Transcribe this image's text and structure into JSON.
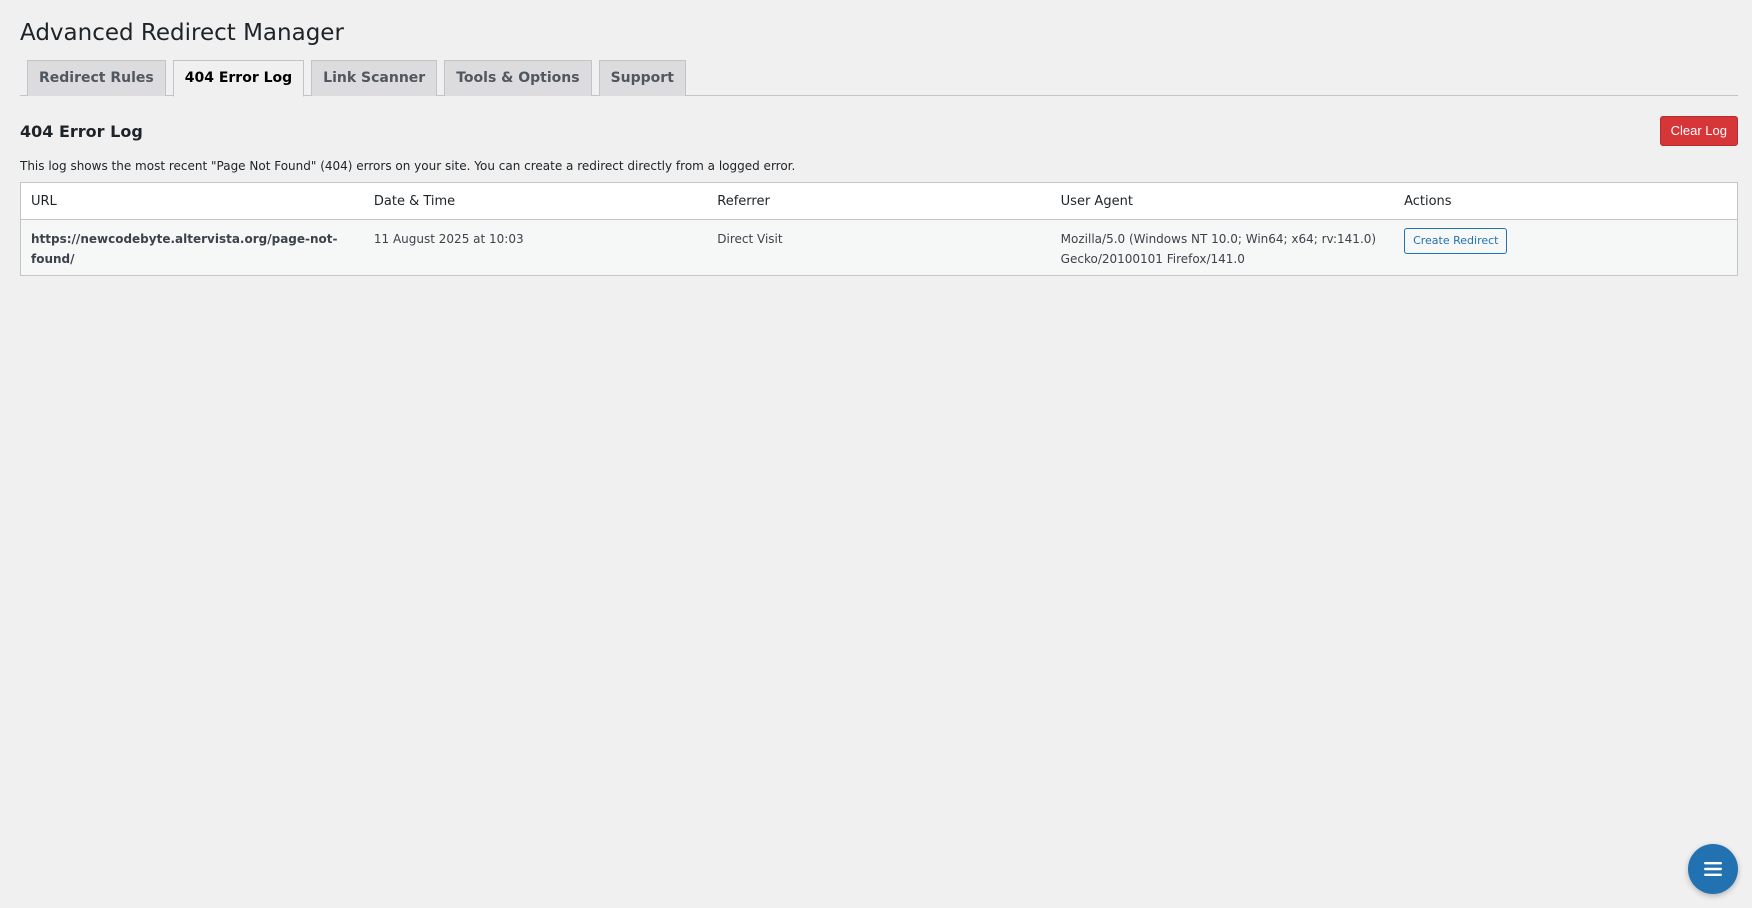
{
  "page": {
    "title": "Advanced Redirect Manager"
  },
  "tabs": [
    {
      "label": "Redirect Rules",
      "active": false
    },
    {
      "label": "404 Error Log",
      "active": true
    },
    {
      "label": "Link Scanner",
      "active": false
    },
    {
      "label": "Tools & Options",
      "active": false
    },
    {
      "label": "Support",
      "active": false
    }
  ],
  "section": {
    "title": "404 Error Log",
    "clear_button": "Clear Log",
    "description": "This log shows the most recent \"Page Not Found\" (404) errors on your site. You can create a redirect directly from a logged error."
  },
  "table": {
    "headers": {
      "url": "URL",
      "date": "Date & Time",
      "referrer": "Referrer",
      "user_agent": "User Agent",
      "actions": "Actions"
    },
    "rows": [
      {
        "url": "https://newcodebyte.altervista.org/page-not-found/",
        "date": "11 August 2025 at 10:03",
        "referrer": "Direct Visit",
        "user_agent": "Mozilla/5.0 (Windows NT 10.0; Win64; x64; rv:141.0) Gecko/20100101 Firefox/141.0",
        "action": "Create Redirect"
      }
    ]
  },
  "colors": {
    "danger": "#d63638",
    "primary": "#2271b1",
    "background": "#f0f0f1"
  },
  "icons": {
    "fab": "menu-icon"
  }
}
